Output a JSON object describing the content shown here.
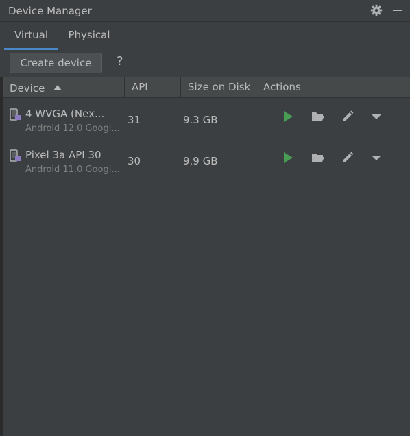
{
  "window": {
    "title": "Device Manager"
  },
  "tabs": [
    {
      "label": "Virtual",
      "active": true
    },
    {
      "label": "Physical",
      "active": false
    }
  ],
  "toolbar": {
    "create_label": "Create device",
    "help_label": "?"
  },
  "table": {
    "columns": [
      "Device",
      "API",
      "Size on Disk",
      "Actions"
    ],
    "sort": {
      "column": "Device",
      "direction": "ascending"
    },
    "rows": [
      {
        "name": "4  WVGA (Nex...",
        "subtitle": "Android 12.0 Googl...",
        "api": "31",
        "size": "9.3 GB"
      },
      {
        "name": "Pixel 3a API 30",
        "subtitle": "Android 11.0 Googl...",
        "api": "30",
        "size": "9.9 GB"
      }
    ]
  },
  "icons": {
    "settings": "gear-icon",
    "minimize": "minimize-icon",
    "device": "phone-device-icon",
    "run": "play-icon",
    "folder": "folder-open-icon",
    "edit": "pencil-icon",
    "menu": "chevron-down-icon",
    "sort": "sort-ascending-icon"
  },
  "colors": {
    "background": "#3c3f41",
    "accent": "#4a88c7",
    "play_green": "#499c54",
    "text": "#bbbbbb",
    "subtext": "#808080"
  }
}
